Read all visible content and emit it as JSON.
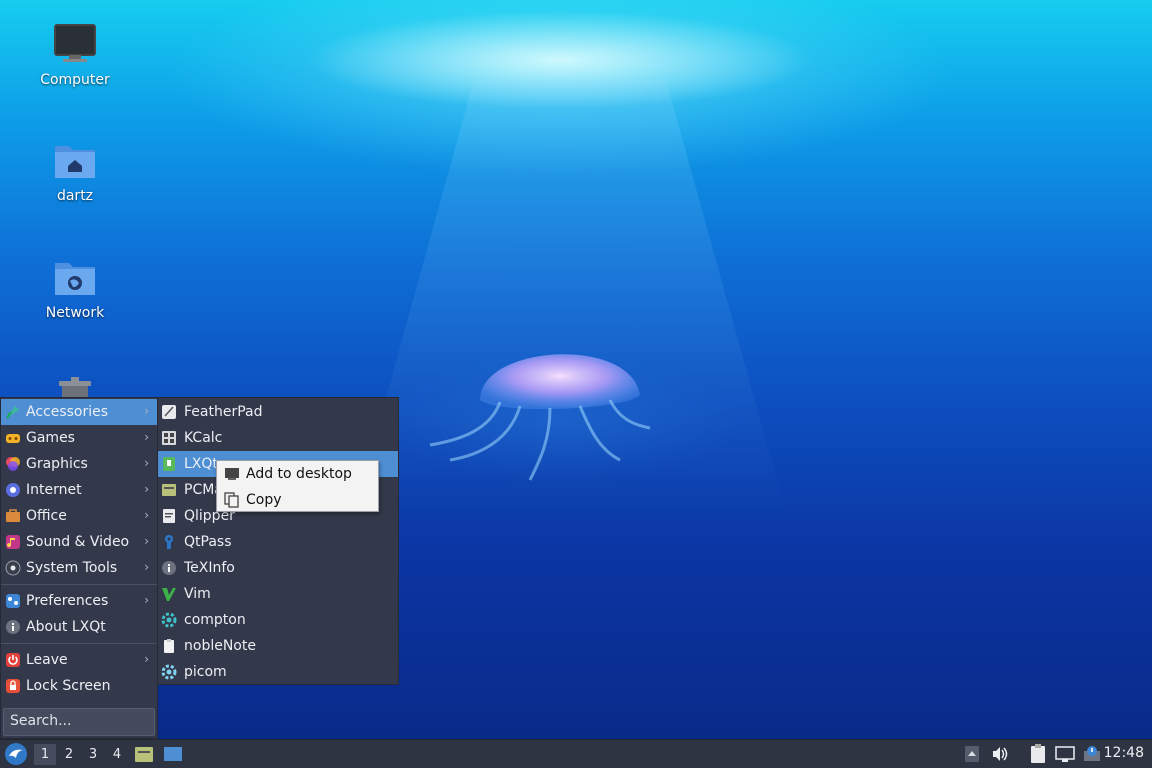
{
  "desktop": {
    "icons": [
      {
        "label": "Computer",
        "icon": "monitor-icon"
      },
      {
        "label": "dartz",
        "icon": "home-folder-icon"
      },
      {
        "label": "Network",
        "icon": "network-folder-icon"
      },
      {
        "label": "",
        "icon": "trash-icon"
      }
    ]
  },
  "menu": {
    "items": [
      {
        "label": "Accessories",
        "icon": "accessories-icon",
        "submenu": true
      },
      {
        "label": "Games",
        "icon": "games-icon",
        "submenu": true
      },
      {
        "label": "Graphics",
        "icon": "graphics-icon",
        "submenu": true
      },
      {
        "label": "Internet",
        "icon": "internet-icon",
        "submenu": true
      },
      {
        "label": "Office",
        "icon": "office-icon",
        "submenu": true
      },
      {
        "label": "Sound & Video",
        "icon": "multimedia-icon",
        "submenu": true
      },
      {
        "label": "System Tools",
        "icon": "system-tools-icon",
        "submenu": true
      },
      {
        "label": "Preferences",
        "icon": "preferences-icon",
        "submenu": true
      },
      {
        "label": "About LXQt",
        "icon": "info-icon",
        "submenu": false
      },
      {
        "label": "Leave",
        "icon": "power-icon",
        "submenu": true
      },
      {
        "label": "Lock Screen",
        "icon": "lock-icon",
        "submenu": false
      }
    ],
    "search_placeholder": "Search..."
  },
  "submenu": {
    "items": [
      {
        "label": "FeatherPad",
        "icon": "featherpad-icon"
      },
      {
        "label": "KCalc",
        "icon": "calculator-icon"
      },
      {
        "label": "LXQt",
        "icon": "lxqt-file-icon"
      },
      {
        "label": "PCMa",
        "icon": "file-manager-icon"
      },
      {
        "label": "Qlipper",
        "icon": "clipboard-icon"
      },
      {
        "label": "QtPass",
        "icon": "password-icon"
      },
      {
        "label": "TeXInfo",
        "icon": "info-icon"
      },
      {
        "label": "Vim",
        "icon": "vim-icon"
      },
      {
        "label": "compton",
        "icon": "gear-icon"
      },
      {
        "label": "nobleNote",
        "icon": "note-icon"
      },
      {
        "label": "picom",
        "icon": "gear-icon"
      }
    ]
  },
  "context_menu": {
    "items": [
      {
        "label": "Add to desktop",
        "icon": "desktop-icon"
      },
      {
        "label": "Copy",
        "icon": "copy-icon"
      }
    ]
  },
  "taskbar": {
    "workspaces": [
      "1",
      "2",
      "3",
      "4"
    ],
    "active_workspace": "1",
    "clock": "12:48"
  },
  "colors": {
    "menu_bg": "#33394a",
    "highlight": "#4e8fd4",
    "taskbar_bg": "#2f3442"
  }
}
